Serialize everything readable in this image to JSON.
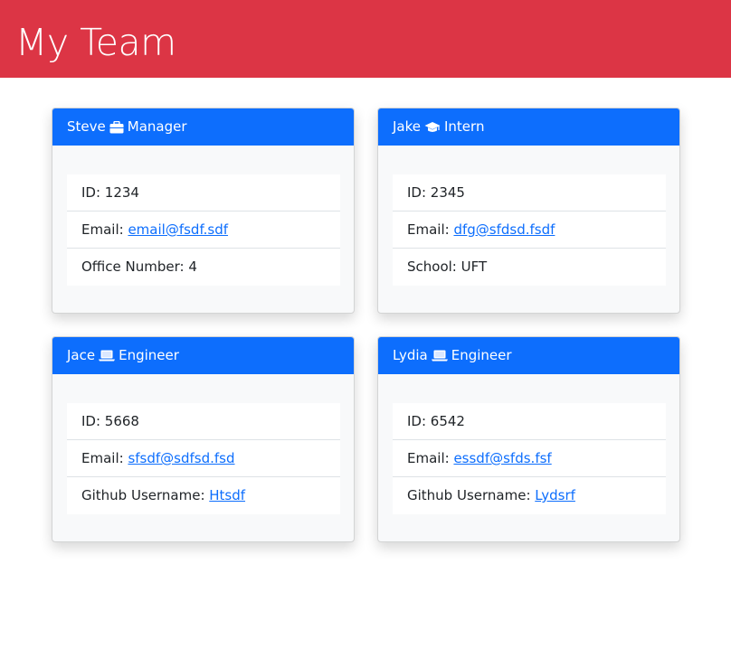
{
  "page": {
    "title": "My Team"
  },
  "colors": {
    "banner": "#dc3545",
    "card_header": "#0d6efd",
    "link": "#0d6efd"
  },
  "cards": [
    {
      "name": "Steve",
      "role": "Manager",
      "icon": "briefcase-icon",
      "id_label": "ID: ",
      "id": "1234",
      "email_label": "Email: ",
      "email": "email@fsdf.sdf",
      "extra_label": "Office Number: ",
      "extra": "4"
    },
    {
      "name": "Jake",
      "role": "Intern",
      "icon": "graduation-cap-icon",
      "id_label": "ID: ",
      "id": "2345",
      "email_label": "Email: ",
      "email": "dfg@sfdsd.fsdf",
      "extra_label": "School: ",
      "extra": "UFT"
    },
    {
      "name": "Jace",
      "role": "Engineer",
      "icon": "laptop-icon",
      "id_label": "ID: ",
      "id": "5668",
      "email_label": "Email: ",
      "email": "sfsdf@sdfsd.fsd",
      "extra_label": "Github Username: ",
      "extra": "Htsdf"
    },
    {
      "name": "Lydia",
      "role": "Engineer",
      "icon": "laptop-icon",
      "id_label": "ID: ",
      "id": "6542",
      "email_label": "Email: ",
      "email": "essdf@sfds.fsf",
      "extra_label": "Github Username: ",
      "extra": "Lydsrf"
    }
  ]
}
